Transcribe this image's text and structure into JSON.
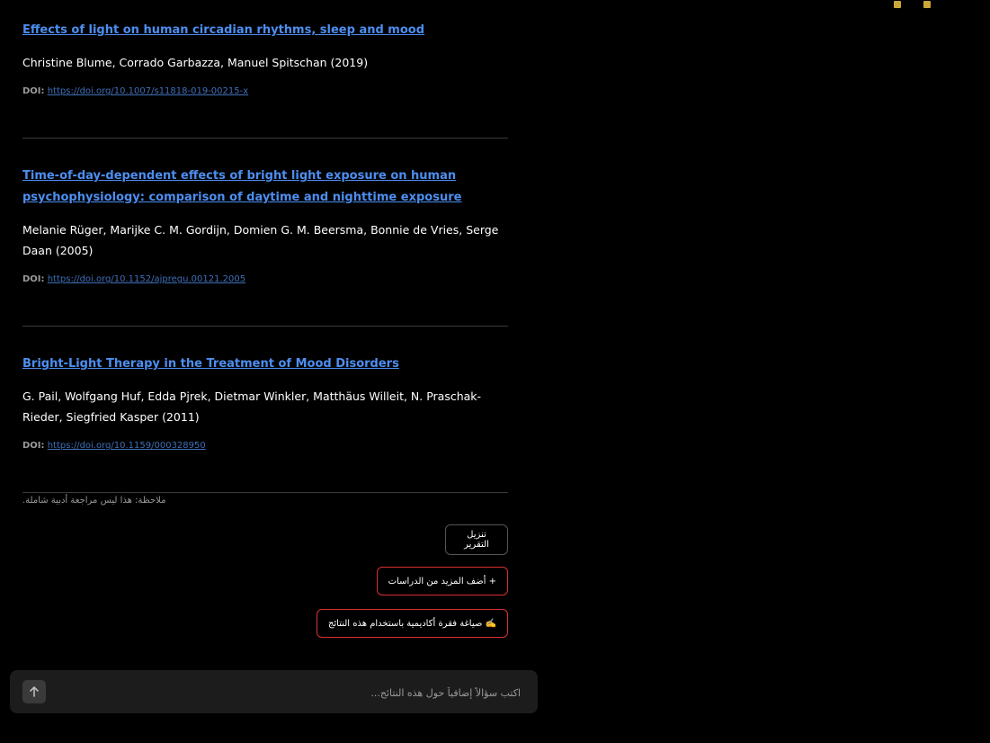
{
  "studies": [
    {
      "title": "Effects of light on human circadian rhythms, sleep and mood",
      "authors": "Christine Blume, Corrado Garbazza, Manuel Spitschan (2019)",
      "doi_label": "DOI:",
      "doi_url": "https://doi.org/10.1007/s11818-019-00215-x"
    },
    {
      "title": "Time-of-day-dependent effects of bright light exposure on human psychophysiology: comparison of daytime and nighttime exposure",
      "authors": "Melanie Rüger, Marijke C. M. Gordijn, Domien G. M. Beersma, Bonnie de Vries, Serge Daan (2005)",
      "doi_label": "DOI:",
      "doi_url": "https://doi.org/10.1152/ajpregu.00121.2005"
    },
    {
      "title": "Bright-Light Therapy in the Treatment of Mood Disorders",
      "authors": "G. Pail, Wolfgang Huf, Edda Pjrek, Dietmar Winkler, Matthäus Willeit, N. Praschak-Rieder, Siegfried Kasper (2011)",
      "doi_label": "DOI:",
      "doi_url": "https://doi.org/10.1159/000328950"
    }
  ],
  "note": "ملاحظة: هذا ليس مراجعة أدبية شاملة.",
  "actions": {
    "download": "تنزيل التقرير",
    "add_more": "+ أضف المزيد من الدراسات",
    "write_paragraph": "✍️ صياغة فقرة أكاديمية باستخدام هذه النتائج"
  },
  "ask": {
    "placeholder": "اكتب سؤالاً إضافياً حول هذه النتائج..."
  },
  "colors": {
    "link": "#4d8ef0",
    "accent_border": "#d93030",
    "background": "#000000"
  }
}
